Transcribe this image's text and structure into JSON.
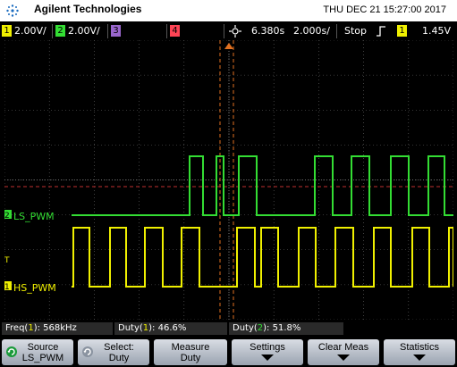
{
  "header": {
    "brand": "Agilent Technologies",
    "datetime": "THU DEC 21 15:27:00 2017"
  },
  "channel_bar": {
    "ch1": {
      "num": "1",
      "value": "2.00V/",
      "color": "#f0f000"
    },
    "ch2": {
      "num": "2",
      "value": "2.00V/",
      "color": "#33dd33"
    },
    "ch3": {
      "num": "3",
      "color": "#9966cc"
    },
    "ch4": {
      "num": "4",
      "color": "#ff4455"
    },
    "time_pos": "6.380s",
    "time_scale": "2.000s/",
    "run_state": "Stop",
    "trigger_source": "1",
    "trigger_level": "1.45V"
  },
  "waveform_labels": {
    "ch2_label": "LS_PWM",
    "ch1_label": "HS_PWM",
    "ch2_marker": "2",
    "ch1_marker": "1",
    "trig_marker": "T"
  },
  "measurements": {
    "freq": {
      "prefix": "Freq(",
      "ch": "1",
      "suffix": "): 568kHz"
    },
    "duty1": {
      "prefix": "Duty(",
      "ch": "1",
      "suffix": "): 46.6%"
    },
    "duty2": {
      "prefix": "Duty(",
      "ch": "2",
      "suffix": "): 51.8%"
    }
  },
  "softkeys": {
    "source": {
      "line1": "Source",
      "line2": "LS_PWM"
    },
    "select": {
      "line1": "Select:",
      "line2": "Duty"
    },
    "measure": {
      "line1": "Measure",
      "line2": "Duty"
    },
    "settings": {
      "line1": "Settings"
    },
    "clear": {
      "line1": "Clear Meas"
    },
    "stats": {
      "line1": "Statistics"
    }
  },
  "colors": {
    "ch1": "#f0f000",
    "ch2": "#33dd33",
    "grid": "#6a6a6a",
    "cursor": "#e07020"
  }
}
